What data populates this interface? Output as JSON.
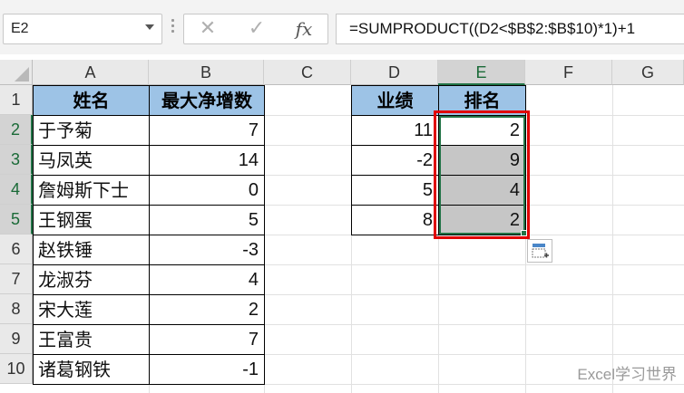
{
  "name_box": "E2",
  "formula_bar": {
    "cancel_icon": "cancel-x-icon",
    "enter_icon": "check-icon",
    "fx_label": "fx",
    "formula": "=SUMPRODUCT((D2<$B$2:$B$10)*1)+1"
  },
  "columns": [
    "A",
    "B",
    "C",
    "D",
    "E",
    "F",
    "G"
  ],
  "rows": [
    "1",
    "2",
    "3",
    "4",
    "5",
    "6",
    "7",
    "8",
    "9",
    "10"
  ],
  "selected_column": "E",
  "table_left": {
    "headers": [
      "姓名",
      "最大净增数"
    ],
    "rows": [
      {
        "name": "于予菊",
        "value": "7"
      },
      {
        "name": "马凤英",
        "value": "14"
      },
      {
        "name": "詹姆斯下士",
        "value": "0"
      },
      {
        "name": "王钢蛋",
        "value": "5"
      },
      {
        "name": "赵铁锤",
        "value": "-3"
      },
      {
        "name": "龙淑芬",
        "value": "4"
      },
      {
        "name": "宋大莲",
        "value": "2"
      },
      {
        "name": "王富贵",
        "value": "7"
      },
      {
        "name": "诸葛钢铁",
        "value": "-1"
      }
    ]
  },
  "table_right": {
    "headers": [
      "业绩",
      "排名"
    ],
    "rows": [
      {
        "score": "11",
        "rank": "2"
      },
      {
        "score": "-2",
        "rank": "9"
      },
      {
        "score": "5",
        "rank": "4"
      },
      {
        "score": "8",
        "rank": "2"
      }
    ]
  },
  "colors": {
    "header_fill": "#9dc3e6",
    "highlight_border": "#e00000",
    "selection": "#217346"
  },
  "watermark": "Excel学习世界"
}
